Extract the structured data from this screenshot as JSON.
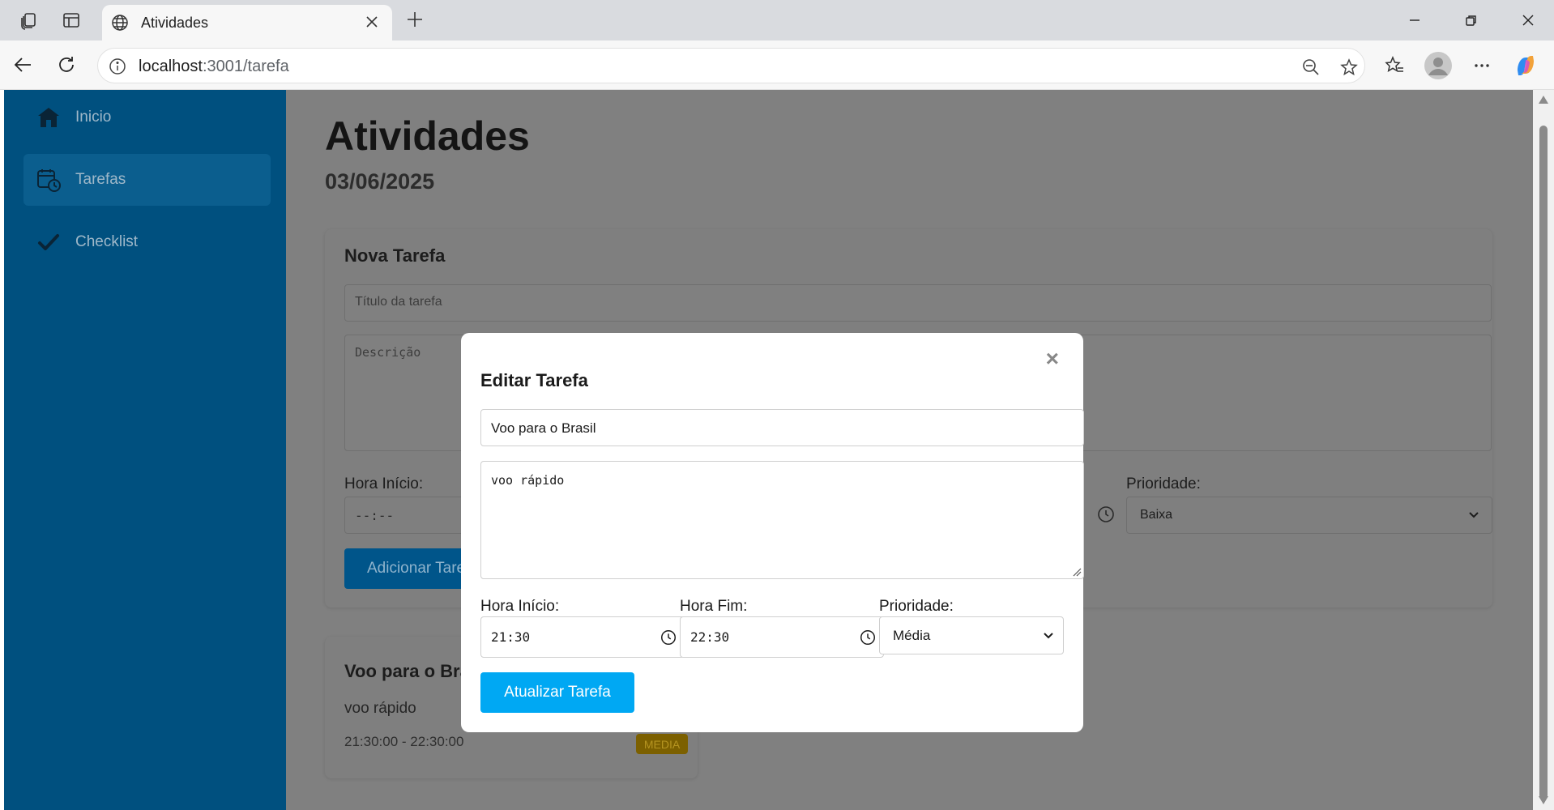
{
  "browser": {
    "tab_title": "Atividades",
    "url_host": "localhost",
    "url_path": ":3001/tarefa"
  },
  "sidebar": {
    "items": [
      {
        "label": "Inicio",
        "icon": "home-icon"
      },
      {
        "label": "Tarefas",
        "icon": "calendar-clock-icon"
      },
      {
        "label": "Checklist",
        "icon": "checkmark-icon"
      }
    ],
    "active_index": 1,
    "background": "#00507f"
  },
  "page": {
    "title": "Atividades",
    "date": "03/06/2025"
  },
  "new_task_form": {
    "heading": "Nova Tarefa",
    "title_placeholder": "Título da tarefa",
    "description_placeholder": "Descrição",
    "start_label": "Hora Início:",
    "start_value": "--:--",
    "priority_label": "Prioridade:",
    "priority_value": "Baixa",
    "submit_label": "Adicionar Tarefa"
  },
  "task_card": {
    "title": "Voo para o Brasil",
    "description": "voo rápido",
    "time_range": "21:30:00 - 22:30:00",
    "priority_badge": "MEDIA"
  },
  "edit_modal": {
    "close_glyph": "×",
    "heading": "Editar Tarefa",
    "title_value": "Voo para o Brasil",
    "description_value": "voo rápido",
    "start_label": "Hora Início:",
    "start_value": "21:30",
    "end_label": "Hora Fim:",
    "end_value": "22:30",
    "priority_label": "Prioridade:",
    "priority_value": "Média",
    "submit_label": "Atualizar Tarefa",
    "accent": "#00a8f3"
  }
}
